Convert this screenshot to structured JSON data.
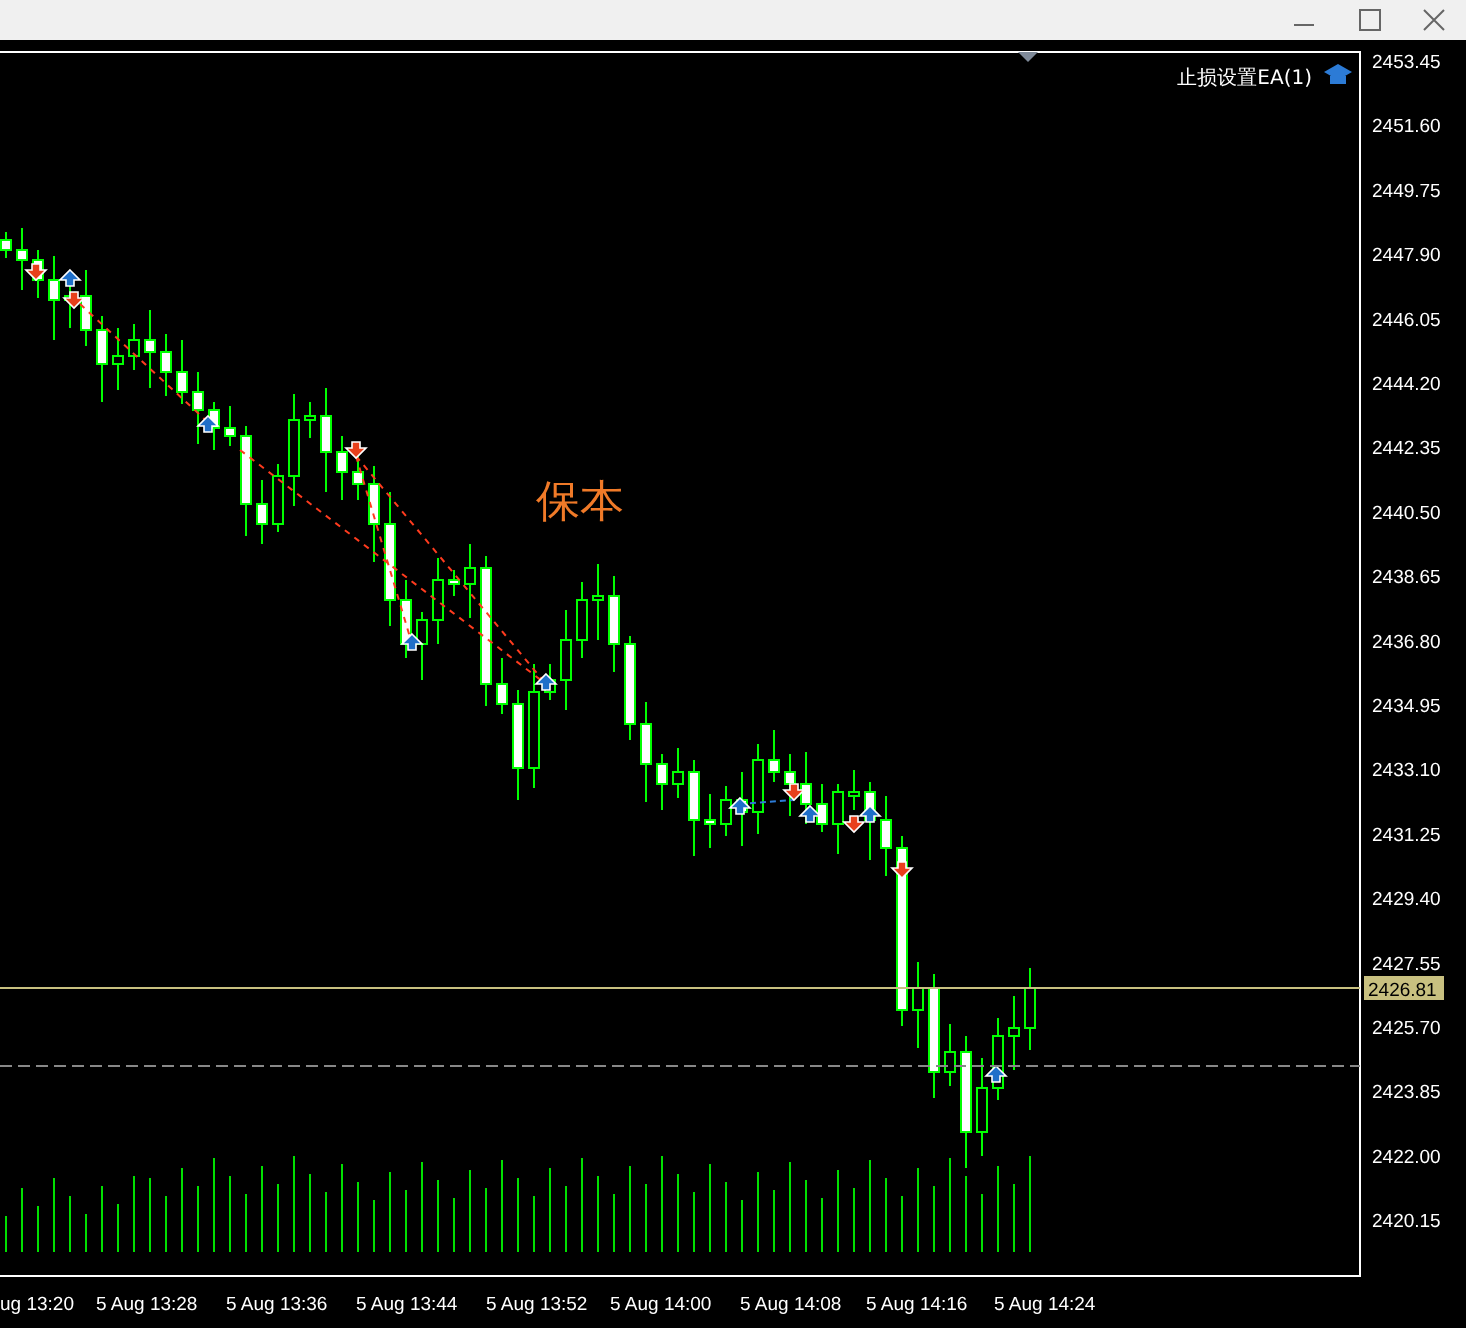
{
  "indicator_label": "止损设置EA(1)",
  "annotation": "保本",
  "price_axis": [
    "2453.45",
    "2451.60",
    "2449.75",
    "2447.90",
    "2446.05",
    "2444.20",
    "2442.35",
    "2440.50",
    "2438.65",
    "2436.80",
    "2434.95",
    "2433.10",
    "2431.25",
    "2429.40",
    "2427.55",
    "2425.70",
    "2423.85",
    "2422.00",
    "2420.15"
  ],
  "current_price": "2426.81",
  "time_axis": [
    "ug 13:20",
    "5 Aug 13:28",
    "5 Aug 13:36",
    "5 Aug 13:44",
    "5 Aug 13:52",
    "5 Aug 14:00",
    "5 Aug 14:08",
    "5 Aug 14:16",
    "5 Aug 14:24"
  ]
}
